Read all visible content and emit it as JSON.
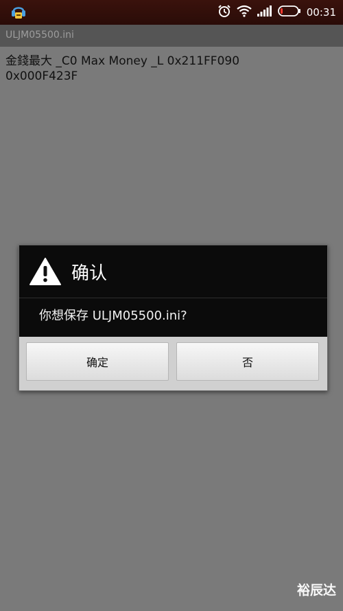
{
  "status_bar": {
    "time": "00:31",
    "icons": [
      "app-notification-icon",
      "alarm-clock-icon",
      "wifi-icon",
      "signal-icon",
      "battery-icon"
    ]
  },
  "title_bar": {
    "title": "ULJM05500.ini"
  },
  "content": {
    "line1": "金錢最大 _C0 Max Money _L 0x211FF090",
    "line2": "0x000F423F"
  },
  "dialog": {
    "title": "确认",
    "message": "你想保存 ULJM05500.ini?",
    "confirm_label": "确定",
    "cancel_label": "否",
    "icon": "warning-icon"
  },
  "watermark": "裕辰达",
  "colors": {
    "status_bar_bg": "#2a0c08",
    "screen_bg": "#7a7a7a",
    "title_bar_bg": "#555555",
    "dialog_bg": "#0b0b0b",
    "button_area_bg": "#d0d0d0"
  }
}
